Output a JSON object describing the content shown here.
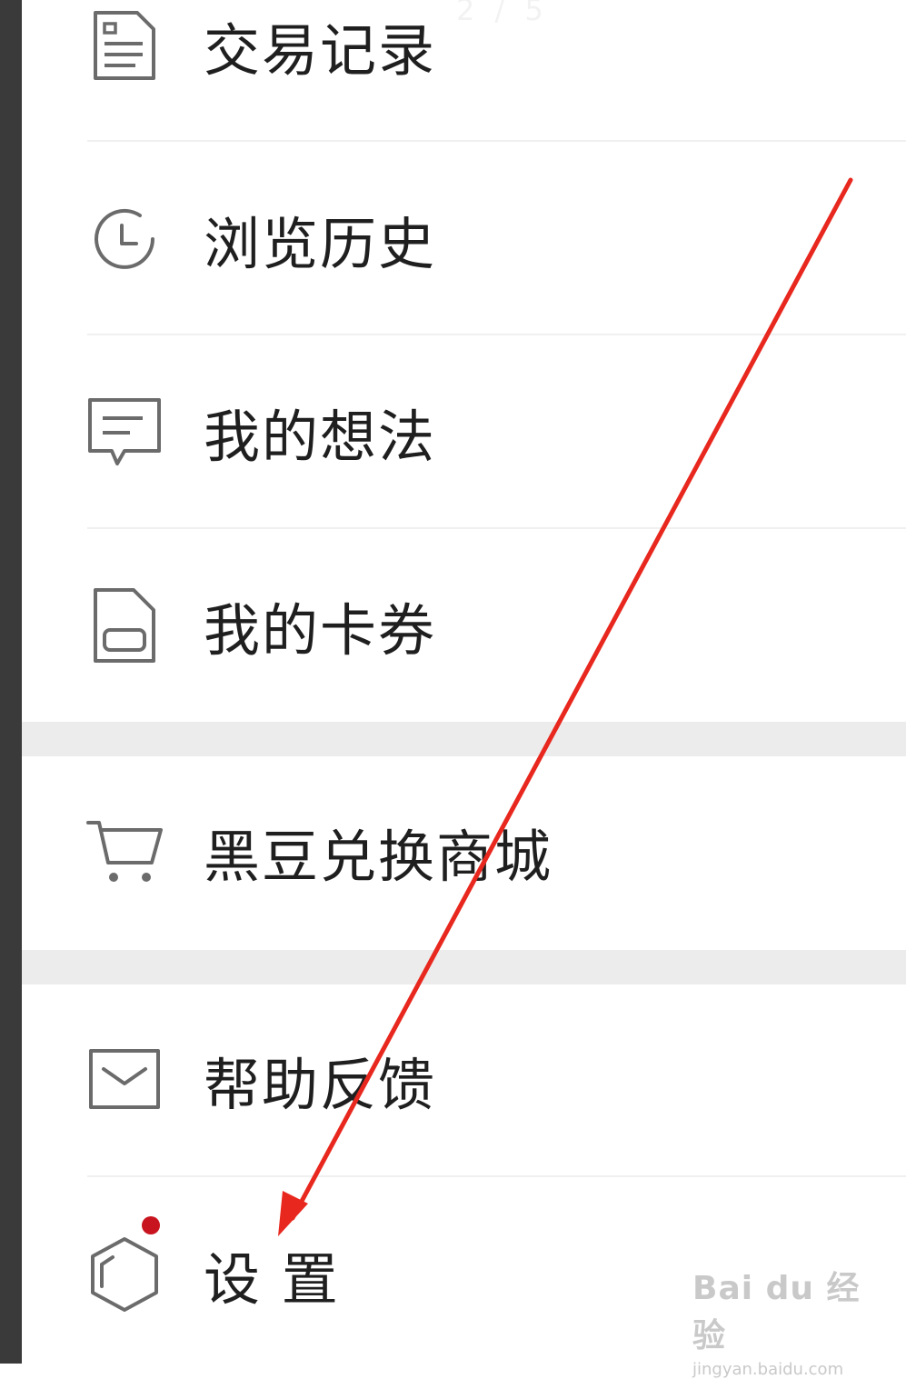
{
  "page_indicator": "2 / 5",
  "menu": {
    "items": [
      {
        "label": "交易记录",
        "icon": "document-list-icon"
      },
      {
        "label": "浏览历史",
        "icon": "clock-icon"
      },
      {
        "label": "我的想法",
        "icon": "chat-bubble-icon"
      },
      {
        "label": "我的卡券",
        "icon": "card-coupon-icon"
      },
      {
        "label": "黑豆兑换商城",
        "icon": "shopping-cart-icon"
      },
      {
        "label": "帮助反馈",
        "icon": "mail-icon"
      },
      {
        "label": "设 置",
        "icon": "hexagon-settings-icon",
        "has_badge": true
      }
    ]
  },
  "annotation": {
    "type": "red-arrow",
    "color": "#e8281e",
    "points_to": "设 置"
  },
  "watermark": {
    "main": "Bai du 经验",
    "sub": "jingyan.baidu.com"
  },
  "colors": {
    "text": "#1f1f1f",
    "icon": "#6b6b6b",
    "badge": "#c8141e",
    "section_band": "#ececec"
  }
}
